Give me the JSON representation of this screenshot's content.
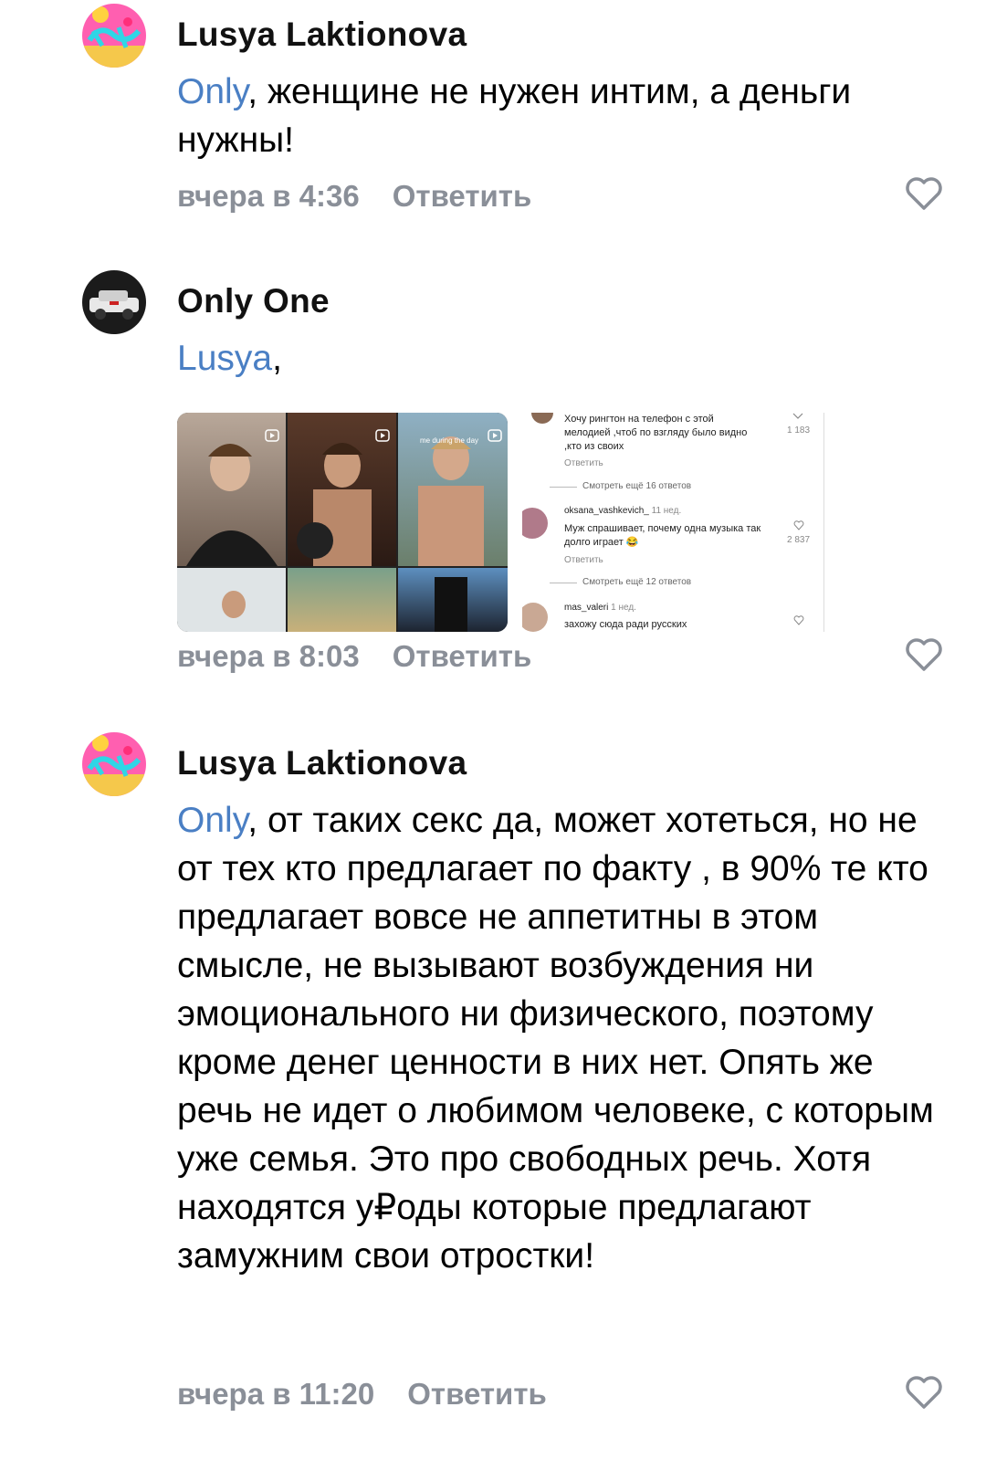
{
  "comments": [
    {
      "author": "Lusya Laktionova",
      "mention": "Only",
      "text": ", женщине не нужен интим, а деньги нужны!",
      "time": "вчера в 4:36",
      "reply": "Ответить"
    },
    {
      "author": "Only One",
      "mention": "Lusya",
      "text": ",",
      "time": "вчера в 8:03",
      "reply": "Ответить",
      "attachment2": {
        "c1_text": "Хочу рингтон на телефон с этой мелодией ,чтоб по взгляду было видно ,кто из своих",
        "c1_reply": "Ответить",
        "c1_likes": "1 183",
        "more1": "Смотреть ещё 16 ответов",
        "c2_user": "oksana_vashkevich_",
        "c2_age": "11 нед.",
        "c2_text": "Муж спрашивает, почему одна музыка так долго играет 😂",
        "c2_reply": "Ответить",
        "c2_likes": "2 837",
        "more2": "Смотреть ещё 12 ответов",
        "c3_user": "mas_valeri",
        "c3_age": "1 нед.",
        "c3_text": "захожу сюда ради русских"
      },
      "attachment1": {
        "caption": "me during the day"
      }
    },
    {
      "author": "Lusya Laktionova",
      "mention": "Only",
      "text": ", от таких секс да, может хотеться, но не от тех кто предлагает по факту , в 90% те кто предлагает вовсе не аппетитны в этом смысле, не вызывают возбуждения ни эмоционального ни физического, поэтому кроме денег ценности в них нет. Опять же речь не идет о любимом человеке, с которым уже семья. Это про свободных речь. Хотя находятся у₽оды которые предлагают замужним свои отростки!",
      "time": "вчера в 11:20",
      "reply": "Ответить"
    }
  ],
  "colors": {
    "mention": "#4a7fc4",
    "meta": "#8a8f98"
  }
}
